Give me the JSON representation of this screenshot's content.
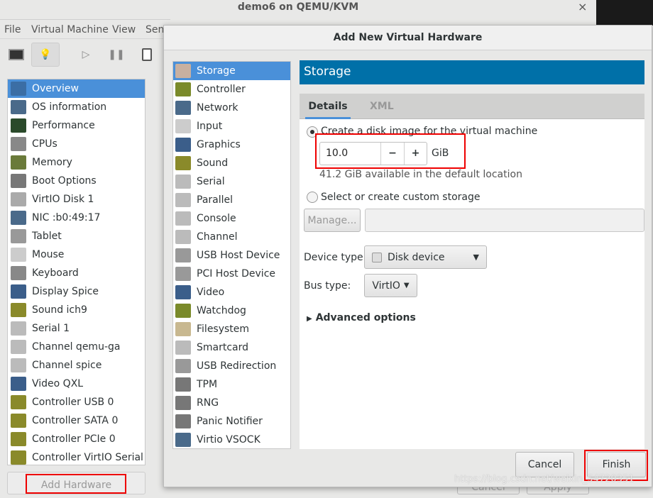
{
  "window": {
    "title": "demo6 on QEMU/KVM",
    "close": "×"
  },
  "menu": [
    "File",
    "Virtual Machine",
    "View",
    "Sen"
  ],
  "toolbar": {
    "icons": [
      "monitor-icon",
      "lightbulb-icon",
      "play-icon",
      "pause-icon",
      "power-icon"
    ]
  },
  "sidebar": {
    "items": [
      {
        "label": "Overview",
        "icon": "#3b6ea5"
      },
      {
        "label": "OS information",
        "icon": "#4a6a8a"
      },
      {
        "label": "Performance",
        "icon": "#2a4a2a"
      },
      {
        "label": "CPUs",
        "icon": "#888"
      },
      {
        "label": "Memory",
        "icon": "#6a7a3a"
      },
      {
        "label": "Boot Options",
        "icon": "#777"
      },
      {
        "label": "VirtIO Disk 1",
        "icon": "#aaa"
      },
      {
        "label": "NIC :b0:49:17",
        "icon": "#4a6a8a"
      },
      {
        "label": "Tablet",
        "icon": "#999"
      },
      {
        "label": "Mouse",
        "icon": "#ccc"
      },
      {
        "label": "Keyboard",
        "icon": "#888"
      },
      {
        "label": "Display Spice",
        "icon": "#3b5e8a"
      },
      {
        "label": "Sound ich9",
        "icon": "#8a8a2a"
      },
      {
        "label": "Serial 1",
        "icon": "#bbb"
      },
      {
        "label": "Channel qemu-ga",
        "icon": "#bbb"
      },
      {
        "label": "Channel spice",
        "icon": "#bbb"
      },
      {
        "label": "Video QXL",
        "icon": "#3b5e8a"
      },
      {
        "label": "Controller USB 0",
        "icon": "#8a8a2a"
      },
      {
        "label": "Controller SATA 0",
        "icon": "#8a8a2a"
      },
      {
        "label": "Controller PCIe 0",
        "icon": "#8a8a2a"
      },
      {
        "label": "Controller VirtIO Serial 0",
        "icon": "#8a8a2a"
      }
    ],
    "add_hardware": "Add Hardware"
  },
  "background_buttons": {
    "cancel": "Cancel",
    "apply": "Apply"
  },
  "dialog": {
    "title": "Add New Virtual Hardware",
    "hardware_types": [
      {
        "label": "Storage",
        "icon": "#c8b0a0"
      },
      {
        "label": "Controller",
        "icon": "#7a8a2a"
      },
      {
        "label": "Network",
        "icon": "#4a6a8a"
      },
      {
        "label": "Input",
        "icon": "#ccc"
      },
      {
        "label": "Graphics",
        "icon": "#3b5e8a"
      },
      {
        "label": "Sound",
        "icon": "#8a8a2a"
      },
      {
        "label": "Serial",
        "icon": "#bbb"
      },
      {
        "label": "Parallel",
        "icon": "#bbb"
      },
      {
        "label": "Console",
        "icon": "#bbb"
      },
      {
        "label": "Channel",
        "icon": "#bbb"
      },
      {
        "label": "USB Host Device",
        "icon": "#999"
      },
      {
        "label": "PCI Host Device",
        "icon": "#999"
      },
      {
        "label": "Video",
        "icon": "#3b5e8a"
      },
      {
        "label": "Watchdog",
        "icon": "#7a8a2a"
      },
      {
        "label": "Filesystem",
        "icon": "#c8b890"
      },
      {
        "label": "Smartcard",
        "icon": "#bbb"
      },
      {
        "label": "USB Redirection",
        "icon": "#999"
      },
      {
        "label": "TPM",
        "icon": "#777"
      },
      {
        "label": "RNG",
        "icon": "#777"
      },
      {
        "label": "Panic Notifier",
        "icon": "#777"
      },
      {
        "label": "Virtio VSOCK",
        "icon": "#4a6a8a"
      }
    ],
    "selected": "Storage",
    "panel_title": "Storage",
    "tabs": [
      "Details",
      "XML"
    ],
    "create_disk_label": "Create a disk image for the virtual machine",
    "size_value": "10.0",
    "size_unit": "GiB",
    "minus": "−",
    "plus": "+",
    "available": "41.2 GiB available in the default location",
    "custom_label": "Select or create custom storage",
    "manage_button": "Manage...",
    "custom_path": "",
    "device_type_label": "Device type:",
    "device_type_value": "Disk device",
    "bus_type_label": "Bus type:",
    "bus_type_value": "VirtIO",
    "advanced": "Advanced options",
    "cancel": "Cancel",
    "finish": "Finish"
  },
  "colors": {
    "accent": "#4a90d9",
    "header": "#0070a8",
    "highlight": "#ff0000"
  },
  "watermark": "https://blog.csdn.net/weixin_54720351"
}
